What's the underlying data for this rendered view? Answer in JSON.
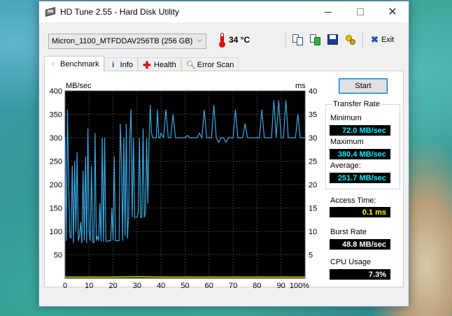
{
  "window": {
    "title": "HD Tune 2.55 - Hard Disk Utility"
  },
  "toolbar": {
    "drive": "Micron_1100_MTFDDAV256TB (256 GB)",
    "temperature": "34 °C",
    "exit_label": "Exit"
  },
  "tabs": [
    {
      "label": "Benchmark"
    },
    {
      "label": "Info"
    },
    {
      "label": "Health"
    },
    {
      "label": "Error Scan"
    }
  ],
  "buttons": {
    "start": "Start"
  },
  "stats": {
    "transfer_rate_label": "Transfer Rate",
    "minimum_label": "Minimum",
    "minimum_value": "72.0 MB/sec",
    "maximum_label": "Maximum",
    "maximum_value": "380.4 MB/sec",
    "average_label": "Average:",
    "average_value": "251.7 MB/sec",
    "access_time_label": "Access Time:",
    "access_time_value": "0.1 ms",
    "burst_rate_label": "Burst Rate",
    "burst_rate_value": "48.8 MB/sec",
    "cpu_usage_label": "CPU Usage",
    "cpu_usage_value": "7.3%"
  },
  "chart_data": {
    "type": "line",
    "left_axis_label": "MB/sec",
    "right_axis_label": "ms",
    "ylim": [
      0,
      400
    ],
    "y2lim": [
      0,
      40
    ],
    "y_ticks": [
      50,
      100,
      150,
      200,
      250,
      300,
      350,
      400
    ],
    "y2_ticks": [
      5,
      10,
      15,
      20,
      25,
      30,
      35,
      40
    ],
    "x_ticks": [
      "0",
      "10",
      "20",
      "30",
      "40",
      "50",
      "60",
      "70",
      "80",
      "90",
      "100%"
    ],
    "grid": true,
    "colors": {
      "background": "#000000",
      "grid": "#3c3c3c",
      "transfer": "#3aa6e0",
      "access": "#d8d000"
    },
    "series": [
      {
        "x": [
          0,
          0.5,
          1,
          1.5,
          2,
          2.5,
          3,
          3.5,
          4,
          4.5,
          5,
          5.5,
          6,
          6.5,
          7,
          7.5,
          8,
          8.5,
          9,
          9.5,
          10,
          10.5,
          11,
          11.5,
          12,
          12.5,
          13,
          13.5,
          14,
          14.5,
          15,
          15.5,
          16,
          16.5,
          17,
          17.5,
          18,
          18.5,
          19,
          19.5,
          20,
          20.5,
          21,
          21.5,
          22,
          22.5,
          23,
          23.5,
          24,
          24.5,
          25,
          25.5,
          26,
          26.5,
          27,
          27.5,
          28,
          28.5,
          29,
          29.5,
          30,
          30.5,
          31,
          31.5,
          32,
          32.5,
          33,
          33.5,
          34,
          34.5,
          35,
          35.5,
          36,
          36.5,
          37,
          37.5,
          38,
          38.5,
          39,
          39.5,
          40,
          41,
          42,
          43,
          44,
          45,
          46,
          47,
          48,
          49,
          50,
          51,
          52,
          53,
          54,
          55,
          56,
          57,
          58,
          59,
          60,
          61,
          62,
          63,
          64,
          65,
          66,
          67,
          68,
          69,
          70,
          71,
          72,
          73,
          74,
          75,
          76,
          77,
          78,
          79,
          80,
          81,
          82,
          83,
          84,
          85,
          86,
          87,
          88,
          89,
          90,
          91,
          92,
          93,
          94,
          95,
          96,
          97,
          98,
          99,
          100
        ],
        "values": [
          300,
          80,
          360,
          200,
          90,
          85,
          240,
          75,
          250,
          100,
          270,
          80,
          90,
          120,
          75,
          230,
          80,
          260,
          75,
          320,
          100,
          80,
          240,
          80,
          75,
          310,
          80,
          90,
          80,
          160,
          78,
          300,
          78,
          300,
          80,
          78,
          80,
          80,
          80,
          150,
          80,
          260,
          80,
          80,
          80,
          80,
          330,
          250,
          80,
          300,
          90,
          330,
          85,
          140,
          300,
          360,
          130,
          300,
          130,
          130,
          130,
          140,
          300,
          130,
          130,
          320,
          130,
          140,
          300,
          160,
          300,
          370,
          310,
          300,
          300,
          300,
          300,
          360,
          300,
          300,
          310,
          300,
          360,
          300,
          300,
          350,
          300,
          300,
          300,
          300,
          300,
          305,
          300,
          300,
          300,
          300,
          310,
          300,
          360,
          300,
          300,
          300,
          370,
          300,
          290,
          300,
          300,
          290,
          300,
          300,
          300,
          360,
          300,
          300,
          300,
          330,
          300,
          300,
          300,
          300,
          300,
          300,
          360,
          300,
          300,
          300,
          300,
          380,
          300,
          380,
          300,
          300,
          380,
          300,
          300,
          300,
          300,
          350,
          300,
          300,
          300
        ]
      },
      {
        "name": "access",
        "x": [
          0,
          10,
          20,
          30,
          40,
          50,
          60,
          70,
          80,
          90,
          100
        ],
        "values": [
          0.1,
          0.1,
          0.1,
          0.2,
          0.1,
          0.1,
          0.1,
          0.1,
          0.1,
          0.1,
          0.1
        ]
      }
    ]
  }
}
